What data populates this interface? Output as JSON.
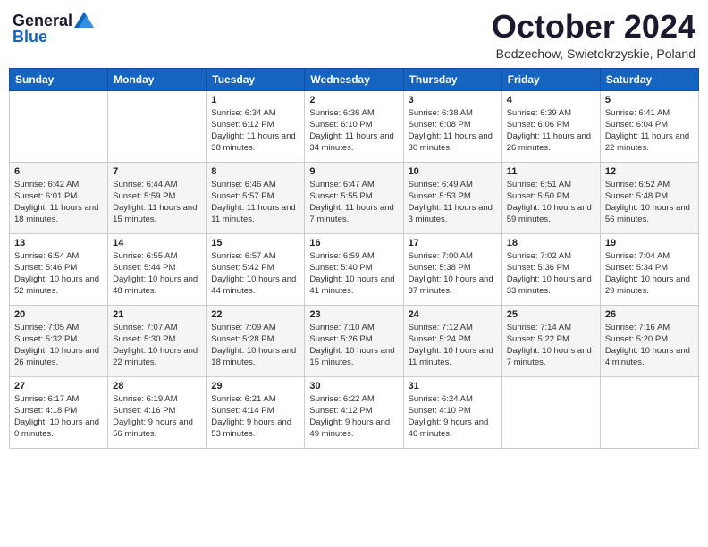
{
  "header": {
    "logo_general": "General",
    "logo_blue": "Blue",
    "month_title": "October 2024",
    "location": "Bodzechow, Swietokrzyskie, Poland"
  },
  "days_of_week": [
    "Sunday",
    "Monday",
    "Tuesday",
    "Wednesday",
    "Thursday",
    "Friday",
    "Saturday"
  ],
  "weeks": [
    [
      {
        "day": "",
        "sunrise": "",
        "sunset": "",
        "daylight": ""
      },
      {
        "day": "",
        "sunrise": "",
        "sunset": "",
        "daylight": ""
      },
      {
        "day": "1",
        "sunrise": "Sunrise: 6:34 AM",
        "sunset": "Sunset: 6:12 PM",
        "daylight": "Daylight: 11 hours and 38 minutes."
      },
      {
        "day": "2",
        "sunrise": "Sunrise: 6:36 AM",
        "sunset": "Sunset: 6:10 PM",
        "daylight": "Daylight: 11 hours and 34 minutes."
      },
      {
        "day": "3",
        "sunrise": "Sunrise: 6:38 AM",
        "sunset": "Sunset: 6:08 PM",
        "daylight": "Daylight: 11 hours and 30 minutes."
      },
      {
        "day": "4",
        "sunrise": "Sunrise: 6:39 AM",
        "sunset": "Sunset: 6:06 PM",
        "daylight": "Daylight: 11 hours and 26 minutes."
      },
      {
        "day": "5",
        "sunrise": "Sunrise: 6:41 AM",
        "sunset": "Sunset: 6:04 PM",
        "daylight": "Daylight: 11 hours and 22 minutes."
      }
    ],
    [
      {
        "day": "6",
        "sunrise": "Sunrise: 6:42 AM",
        "sunset": "Sunset: 6:01 PM",
        "daylight": "Daylight: 11 hours and 18 minutes."
      },
      {
        "day": "7",
        "sunrise": "Sunrise: 6:44 AM",
        "sunset": "Sunset: 5:59 PM",
        "daylight": "Daylight: 11 hours and 15 minutes."
      },
      {
        "day": "8",
        "sunrise": "Sunrise: 6:46 AM",
        "sunset": "Sunset: 5:57 PM",
        "daylight": "Daylight: 11 hours and 11 minutes."
      },
      {
        "day": "9",
        "sunrise": "Sunrise: 6:47 AM",
        "sunset": "Sunset: 5:55 PM",
        "daylight": "Daylight: 11 hours and 7 minutes."
      },
      {
        "day": "10",
        "sunrise": "Sunrise: 6:49 AM",
        "sunset": "Sunset: 5:53 PM",
        "daylight": "Daylight: 11 hours and 3 minutes."
      },
      {
        "day": "11",
        "sunrise": "Sunrise: 6:51 AM",
        "sunset": "Sunset: 5:50 PM",
        "daylight": "Daylight: 10 hours and 59 minutes."
      },
      {
        "day": "12",
        "sunrise": "Sunrise: 6:52 AM",
        "sunset": "Sunset: 5:48 PM",
        "daylight": "Daylight: 10 hours and 56 minutes."
      }
    ],
    [
      {
        "day": "13",
        "sunrise": "Sunrise: 6:54 AM",
        "sunset": "Sunset: 5:46 PM",
        "daylight": "Daylight: 10 hours and 52 minutes."
      },
      {
        "day": "14",
        "sunrise": "Sunrise: 6:55 AM",
        "sunset": "Sunset: 5:44 PM",
        "daylight": "Daylight: 10 hours and 48 minutes."
      },
      {
        "day": "15",
        "sunrise": "Sunrise: 6:57 AM",
        "sunset": "Sunset: 5:42 PM",
        "daylight": "Daylight: 10 hours and 44 minutes."
      },
      {
        "day": "16",
        "sunrise": "Sunrise: 6:59 AM",
        "sunset": "Sunset: 5:40 PM",
        "daylight": "Daylight: 10 hours and 41 minutes."
      },
      {
        "day": "17",
        "sunrise": "Sunrise: 7:00 AM",
        "sunset": "Sunset: 5:38 PM",
        "daylight": "Daylight: 10 hours and 37 minutes."
      },
      {
        "day": "18",
        "sunrise": "Sunrise: 7:02 AM",
        "sunset": "Sunset: 5:36 PM",
        "daylight": "Daylight: 10 hours and 33 minutes."
      },
      {
        "day": "19",
        "sunrise": "Sunrise: 7:04 AM",
        "sunset": "Sunset: 5:34 PM",
        "daylight": "Daylight: 10 hours and 29 minutes."
      }
    ],
    [
      {
        "day": "20",
        "sunrise": "Sunrise: 7:05 AM",
        "sunset": "Sunset: 5:32 PM",
        "daylight": "Daylight: 10 hours and 26 minutes."
      },
      {
        "day": "21",
        "sunrise": "Sunrise: 7:07 AM",
        "sunset": "Sunset: 5:30 PM",
        "daylight": "Daylight: 10 hours and 22 minutes."
      },
      {
        "day": "22",
        "sunrise": "Sunrise: 7:09 AM",
        "sunset": "Sunset: 5:28 PM",
        "daylight": "Daylight: 10 hours and 18 minutes."
      },
      {
        "day": "23",
        "sunrise": "Sunrise: 7:10 AM",
        "sunset": "Sunset: 5:26 PM",
        "daylight": "Daylight: 10 hours and 15 minutes."
      },
      {
        "day": "24",
        "sunrise": "Sunrise: 7:12 AM",
        "sunset": "Sunset: 5:24 PM",
        "daylight": "Daylight: 10 hours and 11 minutes."
      },
      {
        "day": "25",
        "sunrise": "Sunrise: 7:14 AM",
        "sunset": "Sunset: 5:22 PM",
        "daylight": "Daylight: 10 hours and 7 minutes."
      },
      {
        "day": "26",
        "sunrise": "Sunrise: 7:16 AM",
        "sunset": "Sunset: 5:20 PM",
        "daylight": "Daylight: 10 hours and 4 minutes."
      }
    ],
    [
      {
        "day": "27",
        "sunrise": "Sunrise: 6:17 AM",
        "sunset": "Sunset: 4:18 PM",
        "daylight": "Daylight: 10 hours and 0 minutes."
      },
      {
        "day": "28",
        "sunrise": "Sunrise: 6:19 AM",
        "sunset": "Sunset: 4:16 PM",
        "daylight": "Daylight: 9 hours and 56 minutes."
      },
      {
        "day": "29",
        "sunrise": "Sunrise: 6:21 AM",
        "sunset": "Sunset: 4:14 PM",
        "daylight": "Daylight: 9 hours and 53 minutes."
      },
      {
        "day": "30",
        "sunrise": "Sunrise: 6:22 AM",
        "sunset": "Sunset: 4:12 PM",
        "daylight": "Daylight: 9 hours and 49 minutes."
      },
      {
        "day": "31",
        "sunrise": "Sunrise: 6:24 AM",
        "sunset": "Sunset: 4:10 PM",
        "daylight": "Daylight: 9 hours and 46 minutes."
      },
      {
        "day": "",
        "sunrise": "",
        "sunset": "",
        "daylight": ""
      },
      {
        "day": "",
        "sunrise": "",
        "sunset": "",
        "daylight": ""
      }
    ]
  ]
}
